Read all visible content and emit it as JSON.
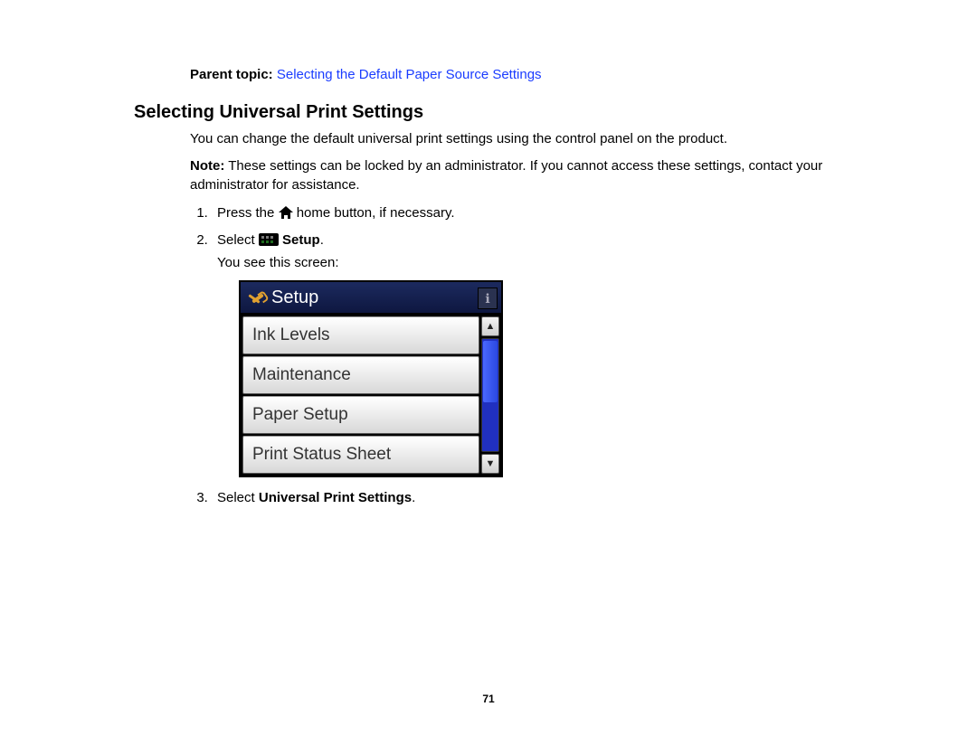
{
  "parent_topic_label": "Parent topic:",
  "parent_topic_link": "Selecting the Default Paper Source Settings",
  "heading": "Selecting Universal Print Settings",
  "intro": "You can change the default universal print settings using the control panel on the product.",
  "note_label": "Note:",
  "note_body": " These settings can be locked by an administrator. If you cannot access these settings, contact your administrator for assistance.",
  "steps": {
    "s1_a": "Press the ",
    "s1_b": " home button, if necessary.",
    "s2_a": "Select ",
    "s2_bold": " Setup",
    "s2_c": ".",
    "s2_sub": "You see this screen:",
    "s3_a": "Select ",
    "s3_bold": "Universal Print Settings",
    "s3_c": "."
  },
  "lcd": {
    "title": "Setup",
    "items": [
      "Ink Levels",
      "Maintenance",
      "Paper Setup",
      "Print Status Sheet"
    ]
  },
  "page_number": "71"
}
